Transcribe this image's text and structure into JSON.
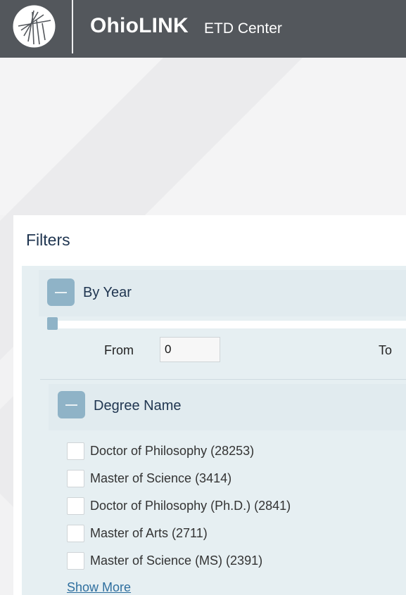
{
  "header": {
    "brand": "OhioLINK",
    "subbrand": "ETD Center",
    "logo_icon": "ohiolink-logo-icon",
    "background_color": "#53575c"
  },
  "filters": {
    "title": "Filters",
    "year_section": {
      "label": "By Year",
      "toggle_icon": "minus-icon",
      "from_label": "From",
      "from_value": "0",
      "to_label": "To"
    },
    "degree_section": {
      "label": "Degree Name",
      "toggle_icon": "minus-icon",
      "items": [
        {
          "label": "Doctor of Philosophy (28253)"
        },
        {
          "label": "Master of Science (3414)"
        },
        {
          "label": "Doctor of Philosophy (Ph.D.) (2841)"
        },
        {
          "label": "Master of Arts (2711)"
        },
        {
          "label": "Master of Science (MS) (2391)"
        }
      ],
      "show_more": "Show More"
    }
  },
  "colors": {
    "accent": "#8fb3c7",
    "panel_bg": "#e6eff2",
    "title_text": "#1f3550",
    "link": "#2f6f9f"
  }
}
